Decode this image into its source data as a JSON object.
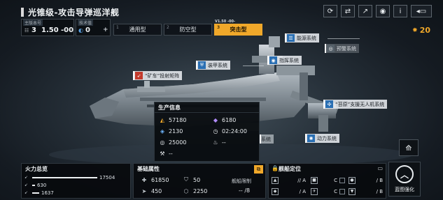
{
  "header": {
    "title": "光锥级-攻击导弹巡洋舰",
    "icons": [
      "refresh-icon",
      "ship-swap-icon",
      "share-icon",
      "view-icon",
      "info-icon",
      "back-icon"
    ]
  },
  "blueprint": {
    "label": "主版本号",
    "tier": "3",
    "version": "1.50",
    "suffix": "-00"
  },
  "tech": {
    "label": "技术值",
    "value": "0"
  },
  "modes": {
    "caption": "V1.50 -00-",
    "tabs": [
      {
        "index": "1",
        "label": "通用型"
      },
      {
        "index": "2",
        "label": "防空型"
      },
      {
        "index": "3",
        "label": "突击型"
      }
    ],
    "active_index": 2
  },
  "currency": {
    "value": "20"
  },
  "systems": {
    "energy": "能源系统",
    "hidden": "预警系统",
    "command": "指挥系统",
    "armor": "装甲系统",
    "railgun": "“矿车”投射矩阵",
    "drone": "“苔原”支援无人机系统",
    "power": "动力系统",
    "partial": "系统"
  },
  "production": {
    "title": "生产信息",
    "metal": "57180",
    "crystal": "6180",
    "deuterium": "2130",
    "time": "02:24:00",
    "ru": "25000",
    "fuel": "--",
    "build": "--"
  },
  "firepower": {
    "title": "火力总览",
    "rows": [
      {
        "value": "17504",
        "fill": 0.93
      },
      {
        "value": "630",
        "fill": 0.04
      },
      {
        "value": "1637",
        "fill": 0.1
      }
    ]
  },
  "attributes": {
    "title": "基础属性",
    "hp": "61850",
    "armor": "50",
    "speed": "450",
    "shield": "2250",
    "limit_label": "舰船限制",
    "limit_value": "-- /8"
  },
  "positioning": {
    "title": "舰船定位",
    "cells": [
      {
        "icon": "▲",
        "grade": "A"
      },
      {
        "icon": "■",
        "grade": "C"
      },
      {
        "icon": "●",
        "grade": "B"
      },
      {
        "icon": "◆",
        "grade": "A"
      },
      {
        "icon": "✈",
        "grade": "C"
      },
      {
        "icon": "▼",
        "grade": "B"
      }
    ]
  },
  "strengthen": {
    "label": "蓝图强化"
  }
}
